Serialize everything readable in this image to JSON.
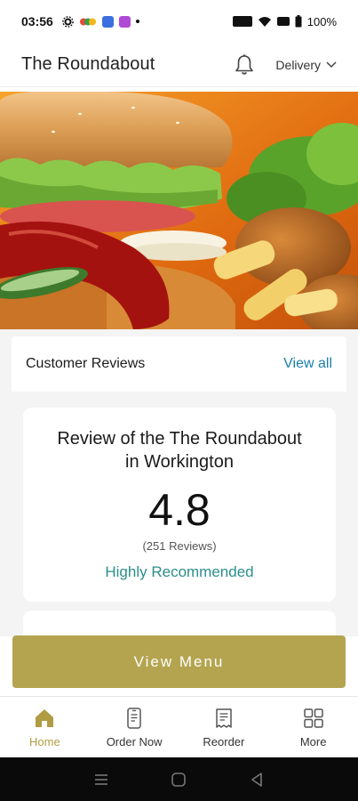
{
  "status_bar": {
    "time": "03:56",
    "battery": "100%"
  },
  "header": {
    "title": "The Roundabout",
    "order_mode": "Delivery"
  },
  "reviews": {
    "section_title": "Customer Reviews",
    "view_all": "View all",
    "card": {
      "heading": "Review of the The Roundabout in Workington",
      "rating": "4.8",
      "count": "(251 Reviews)",
      "verdict": "Highly Recommended"
    }
  },
  "cta": {
    "view_menu": "View Menu"
  },
  "bottom_nav": {
    "items": [
      {
        "label": "Home",
        "icon": "home-icon"
      },
      {
        "label": "Order Now",
        "icon": "phone-order-icon"
      },
      {
        "label": "Reorder",
        "icon": "receipt-icon"
      },
      {
        "label": "More",
        "icon": "grid-icon"
      }
    ]
  },
  "colors": {
    "accent": "#b4a44f",
    "link": "#1a7fa8",
    "recommend": "#2b8f8a"
  }
}
